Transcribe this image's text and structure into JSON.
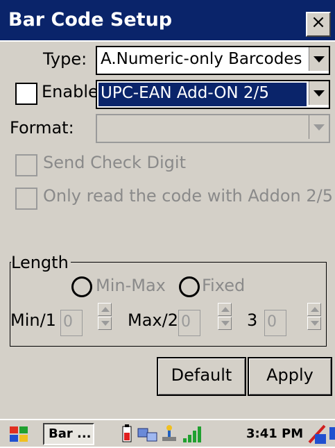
{
  "window": {
    "title": "Bar Code Setup",
    "close_label": "×"
  },
  "type_row": {
    "label": "Type:",
    "value": "A.Numeric-only Barcodes"
  },
  "enable_row": {
    "label": "Enable",
    "checked": false,
    "value": "UPC-EAN Add-ON 2/5"
  },
  "format_row": {
    "label": "Format:",
    "value": ""
  },
  "send_check_digit": {
    "label": "Send Check Digit",
    "checked": false,
    "enabled": false
  },
  "addon_only": {
    "label": "Only read the code with Addon 2/5",
    "checked": false,
    "enabled": false
  },
  "length": {
    "legend": "Length",
    "radio_minmax": "Min-Max",
    "radio_fixed": "Fixed",
    "min_label": "Min/1",
    "min_value": "0",
    "max_label": "Max/2",
    "max_value": "0",
    "third_label": "3",
    "third_value": "0"
  },
  "buttons": {
    "default": "Default",
    "apply": "Apply"
  },
  "taskbar": {
    "task_label": "Bar ...",
    "clock": "3:41 PM"
  },
  "colors": {
    "title_bar": "#0a246a",
    "dialog_bg": "#d4d0c8",
    "selection": "#0a246a"
  }
}
